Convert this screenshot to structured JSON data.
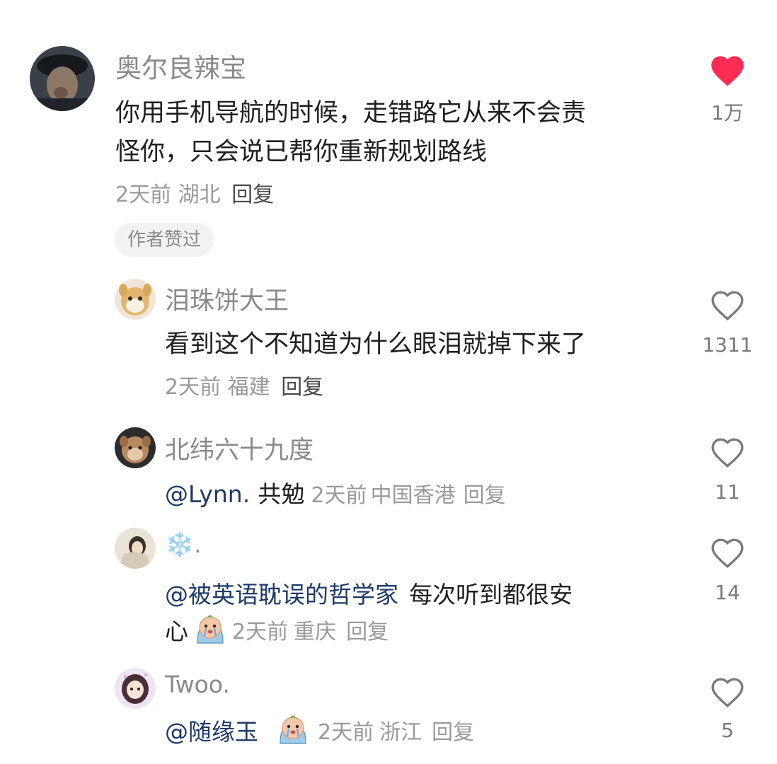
{
  "comment": {
    "user": "奥尔良辣宝",
    "text_line1": "你用手机导航的时候，走错路它从来不会责",
    "text_line2": "怪你，只会说已帮你重新规划路线",
    "time": "2天前",
    "location": "湖北",
    "reply_label": "回复",
    "badge": "作者赞过",
    "likes": "1万",
    "liked": true
  },
  "replies": [
    {
      "user": "泪珠饼大王",
      "text": "看到这个不知道为什么眼泪就掉下来了",
      "time": "2天前",
      "location": "福建",
      "reply_label": "回复",
      "likes": "1311"
    },
    {
      "user": "北纬六十九度",
      "mention": "@Lynn.",
      "text": "共勉",
      "time": "2天前",
      "location": "中国香港",
      "reply_label": "回复",
      "likes": "11"
    },
    {
      "user": "❄️.",
      "mention": "@被英语耽误的哲学家",
      "text_line1": "每次听到都很安",
      "text_line2": "心",
      "emoji": "crying-face-sticker",
      "time": "2天前",
      "location": "重庆",
      "reply_label": "回复",
      "likes": "14"
    },
    {
      "user": "Twoo.",
      "mention": "@随缘玉",
      "emoji": "crying-face-sticker",
      "time": "2天前",
      "location": "浙江",
      "reply_label": "回复",
      "likes": "5"
    }
  ],
  "colors": {
    "liked_heart": "#fe2c55",
    "mention": "#1e3a66"
  }
}
